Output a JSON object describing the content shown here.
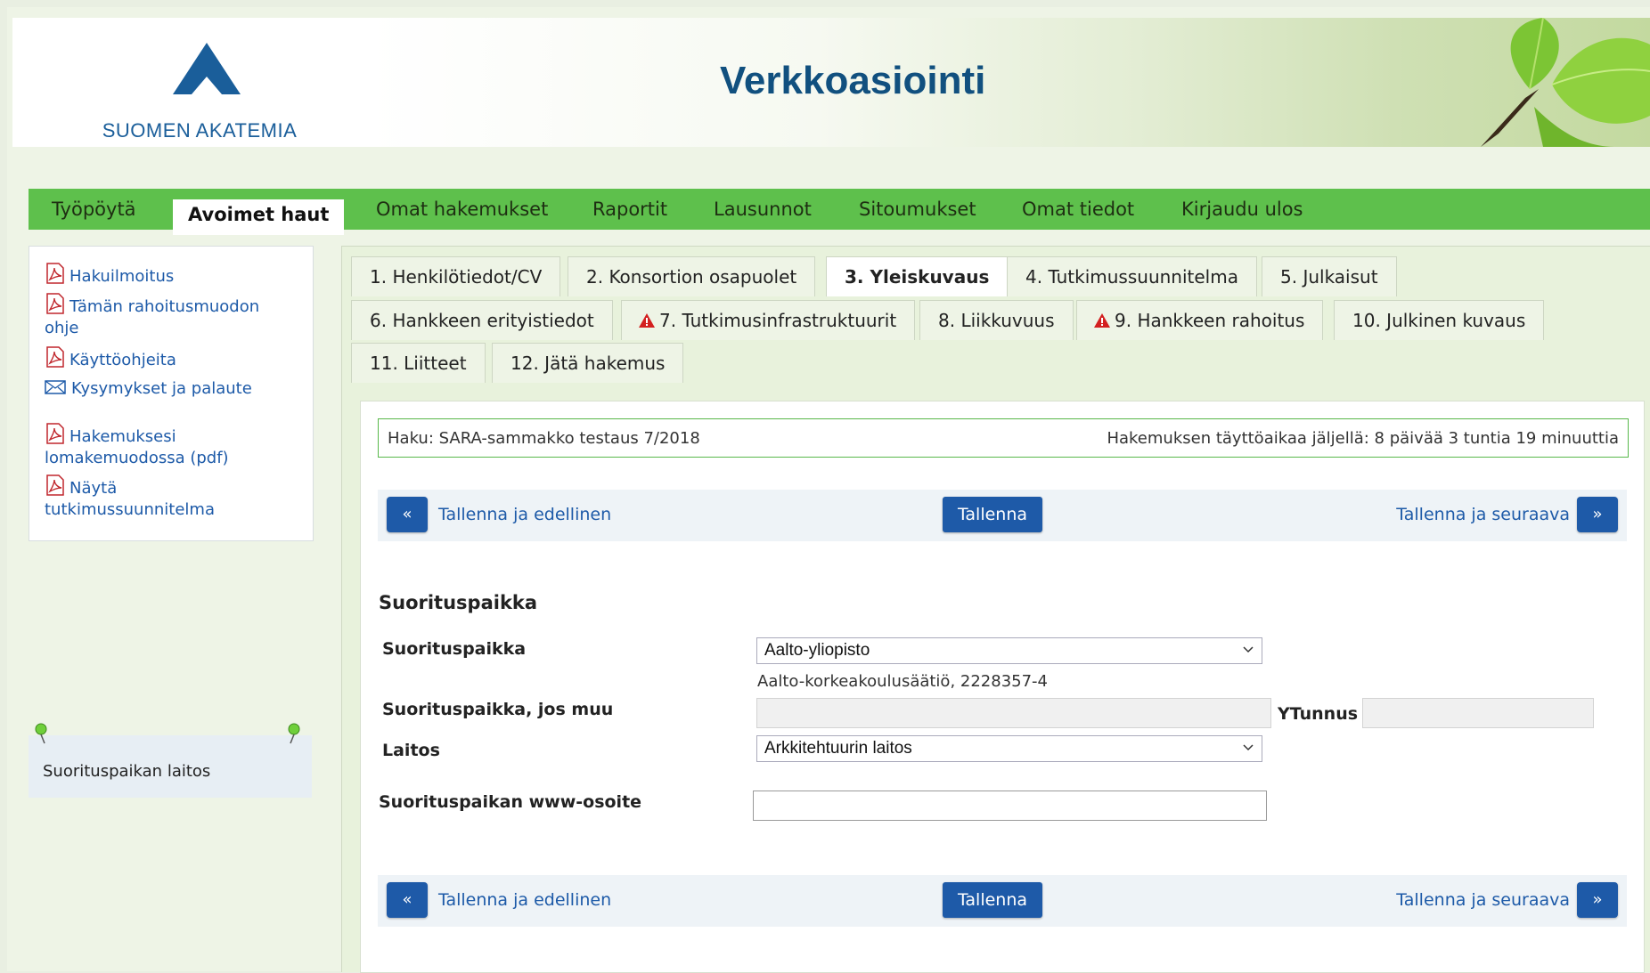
{
  "header": {
    "logo_text": "SUOMEN AKATEMIA",
    "app_title": "Verkkoasiointi"
  },
  "nav": {
    "items": [
      "Työpöytä",
      "Avoimet haut",
      "Omat hakemukset",
      "Raportit",
      "Lausunnot",
      "Sitoumukset",
      "Omat tiedot",
      "Kirjaudu ulos"
    ],
    "active": "Avoimet haut"
  },
  "sidebar": {
    "links": [
      {
        "label": "Hakuilmoitus",
        "icon": "pdf-icon"
      },
      {
        "label": "Tämän rahoitusmuodon",
        "label2": "ohje",
        "icon": "pdf-icon"
      },
      {
        "label": "Käyttöohjeita",
        "icon": "pdf-icon"
      },
      {
        "label": "Kysymykset ja palaute",
        "icon": "mail-icon"
      },
      {
        "label": "Hakemuksesi",
        "label2": "lomakemuodossa (pdf)",
        "icon": "pdf-icon"
      },
      {
        "label": "Näytä",
        "label2": "tutkimussuunnitelma",
        "icon": "pdf-icon"
      }
    ],
    "note": "Suorituspaikan laitos"
  },
  "tabs": [
    {
      "label": "1. Henkilötiedot/CV",
      "warning": false
    },
    {
      "label": "2. Konsortion osapuolet",
      "warning": false
    },
    {
      "label": "3. Yleiskuvaus",
      "warning": false,
      "active": true
    },
    {
      "label": "4. Tutkimussuunnitelma",
      "warning": false
    },
    {
      "label": "5. Julkaisut",
      "warning": false
    },
    {
      "label": "6. Hankkeen erityistiedot",
      "warning": false
    },
    {
      "label": "7. Tutkimusinfrastruktuurit",
      "warning": true
    },
    {
      "label": "8. Liikkuvuus",
      "warning": false
    },
    {
      "label": "9. Hankkeen rahoitus",
      "warning": true
    },
    {
      "label": "10. Julkinen kuvaus",
      "warning": false
    },
    {
      "label": "11. Liitteet",
      "warning": false
    },
    {
      "label": "12. Jätä hakemus",
      "warning": false
    }
  ],
  "haku": {
    "name": "Haku: SARA-sammakko testaus 7/2018",
    "deadline": "Hakemuksen täyttöaikaa jäljellä: 8 päivää 3 tuntia 19 minuuttia"
  },
  "buttons": {
    "prev_arrow": "«",
    "prev_label": "Tallenna ja edellinen",
    "save": "Tallenna",
    "next_label": "Tallenna ja seuraava",
    "next_arrow": "»"
  },
  "form": {
    "section_title": "Suorituspaikka",
    "suorituspaikka_label": "Suorituspaikka",
    "suorituspaikka_value": "Aalto-yliopisto",
    "suorituspaikka_helper": "Aalto-korkeakoulusäätiö, 2228357-4",
    "muu_label": "Suorituspaikka, jos muu",
    "muu_value": "",
    "ytunnus_label": "YTunnus",
    "ytunnus_value": "",
    "laitos_label": "Laitos",
    "laitos_value": "Arkkitehtuurin laitos",
    "www_label": "Suorituspaikan www-osoite",
    "www_value": ""
  },
  "colors": {
    "nav_green": "#5ec04c",
    "link_blue": "#1d5aa8",
    "button_blue": "#1e5aa8",
    "brand_blue": "#1a5e9a",
    "warning_red": "#d32020"
  }
}
